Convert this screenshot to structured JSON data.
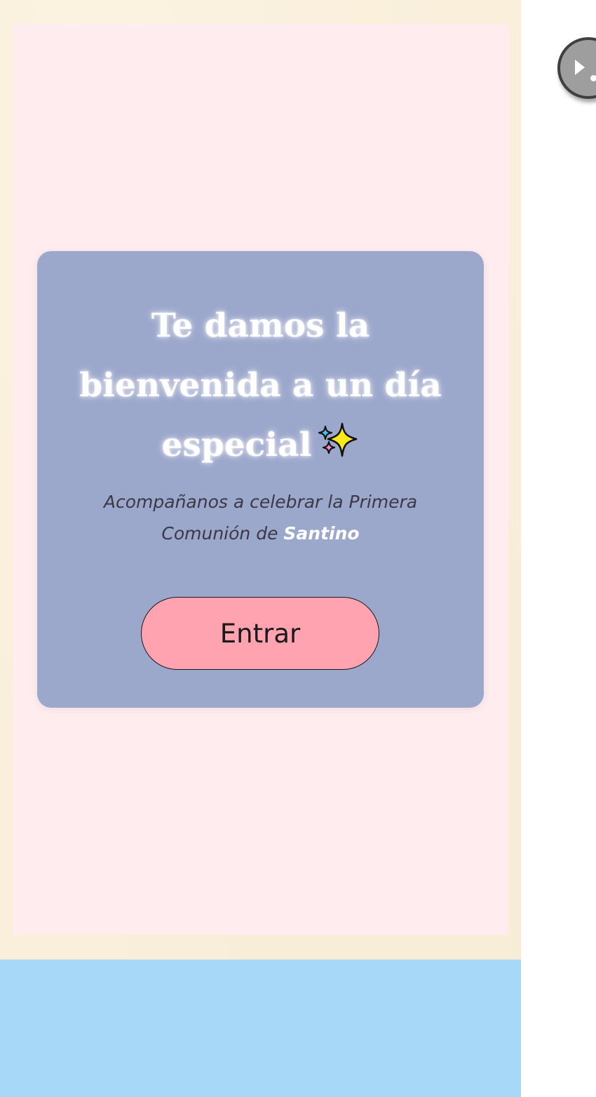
{
  "welcome_card": {
    "title": "Te damos la bienvenida a un día especial",
    "sparkle_icon": "sparkles-icon",
    "subtitle_prefix": "Acompañanos a celebrar la Primera Comunión de",
    "celebrant_name": "Santino",
    "enter_label": "Entrar"
  },
  "music_control": {
    "icon": "play-icon"
  },
  "colors": {
    "page_background": "#f9efdb",
    "panel_pink": "#ffebee",
    "card": "#9ca7cc",
    "button_pink": "#ffa3b1",
    "footer_blue": "#a8d8f7",
    "music_button": "#9e9e9e"
  }
}
